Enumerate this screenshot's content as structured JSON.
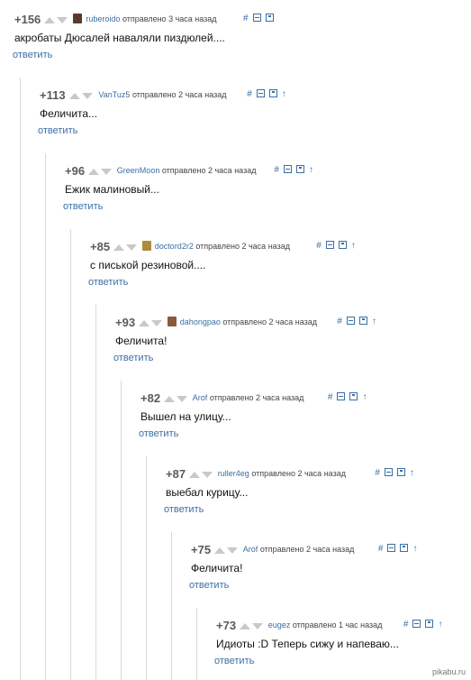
{
  "comments": [
    {
      "rating": "+156",
      "user": "ruberoido",
      "action": "отправлено",
      "time": "3 часа назад",
      "text": "акробаты Дюсалей наваляли пиздюлей....",
      "reply": "ответить",
      "avatar_color": "#5a3a2a"
    },
    {
      "rating": "+113",
      "user": "VanTuz5",
      "action": "отправлено",
      "time": "2 часа назад",
      "text": "Феличита...",
      "reply": "ответить"
    },
    {
      "rating": "+96",
      "user": "GreenMoon",
      "action": "отправлено",
      "time": "2 часа назад",
      "text": "Ежик малиновый...",
      "reply": "ответить"
    },
    {
      "rating": "+85",
      "user": "doctord2r2",
      "action": "отправлено",
      "time": "2 часа назад",
      "text": "с писькой резиновой....",
      "reply": "ответить",
      "avatar_color": "#b08a3a"
    },
    {
      "rating": "+93",
      "user": "dahongpao",
      "action": "отправлено",
      "time": "2 часа назад",
      "text": "Феличита!",
      "reply": "ответить",
      "avatar_color": "#8a5a3a"
    },
    {
      "rating": "+82",
      "user": "Arof",
      "action": "отправлено",
      "time": "2 часа назад",
      "text": "Вышел на улицу...",
      "reply": "ответить"
    },
    {
      "rating": "+87",
      "user": "ruller4eg",
      "action": "отправлено",
      "time": "2 часа назад",
      "text": "выебал курицу...",
      "reply": "ответить"
    },
    {
      "rating": "+75",
      "user": "Arof",
      "action": "отправлено",
      "time": "2 часа назад",
      "text": "Феличита!",
      "reply": "ответить"
    },
    {
      "rating": "+73",
      "user": "eugez",
      "action": "отправлено",
      "time": "1 час назад",
      "text": "Идиоты :D Теперь сижу и напеваю...",
      "reply": "ответить"
    }
  ],
  "tools": {
    "hash": "#",
    "up": "↑"
  },
  "icons": {
    "vote_up": "triangle-up-icon",
    "vote_down": "triangle-down-icon",
    "collapse": "minus-square-icon",
    "save": "save-icon",
    "parent": "arrow-up-icon"
  },
  "watermark": "pikabu.ru",
  "colors": {
    "link": "#3b6fa6",
    "rating": "#5a5a5a",
    "vote_arrow": "#c9c9c9",
    "thread_line": "#d9d9d9"
  }
}
